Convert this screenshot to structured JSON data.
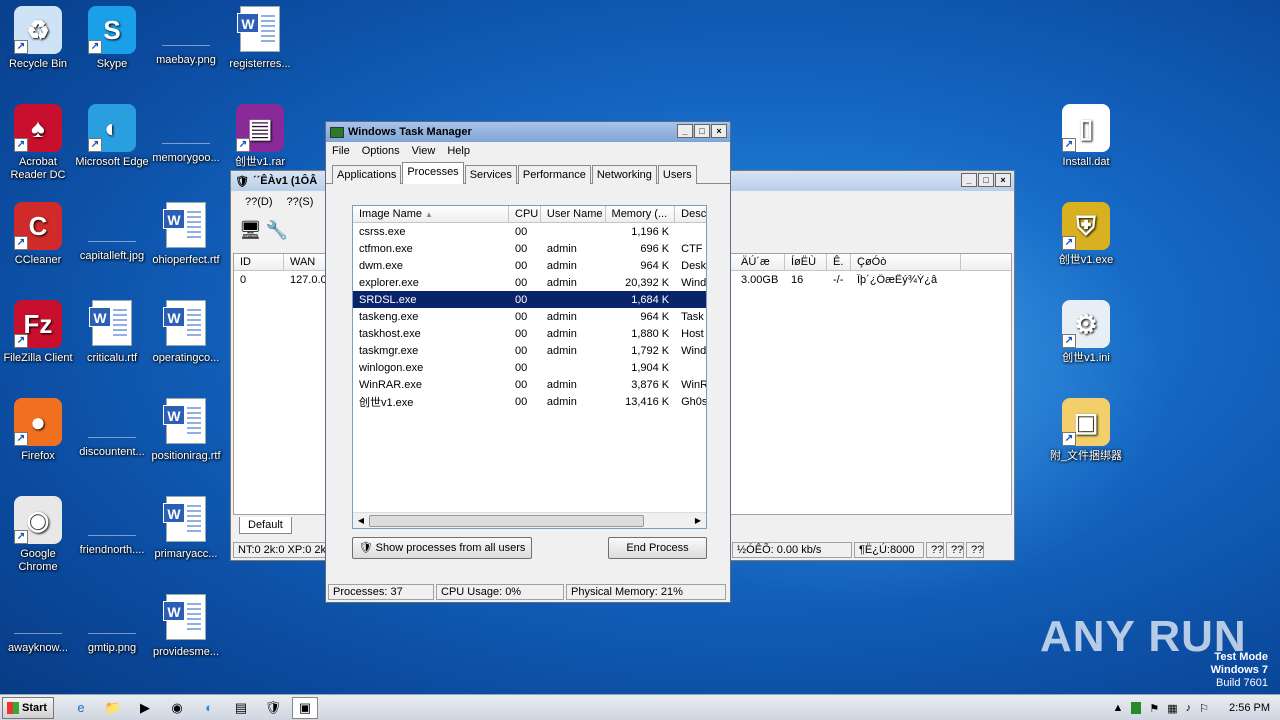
{
  "desktop": {
    "icons": [
      {
        "label": "Recycle Bin",
        "icon": "recycle-bin-icon"
      },
      {
        "label": "Skype",
        "icon": "skype-icon"
      },
      {
        "label": "maebay.png",
        "icon": "image-file-icon"
      },
      {
        "label": "registerres...",
        "icon": "word-doc-icon"
      },
      {
        "label": "Acrobat Reader DC",
        "icon": "acrobat-icon"
      },
      {
        "label": "Microsoft Edge",
        "icon": "edge-icon"
      },
      {
        "label": "memorygoo...",
        "icon": "image-file-icon"
      },
      {
        "label": "创世v1.rar",
        "icon": "winrar-icon"
      },
      {
        "label": "CCleaner",
        "icon": "ccleaner-icon"
      },
      {
        "label": "capitalleft.jpg",
        "icon": "image-file-icon"
      },
      {
        "label": "ohioperfect.rtf",
        "icon": "word-doc-icon"
      },
      {
        "label": "FileZilla Client",
        "icon": "filezilla-icon"
      },
      {
        "label": "criticalu.rtf",
        "icon": "word-doc-icon"
      },
      {
        "label": "operatingco...",
        "icon": "word-doc-icon"
      },
      {
        "label": "Firefox",
        "icon": "firefox-icon"
      },
      {
        "label": "discountent...",
        "icon": "image-file-icon"
      },
      {
        "label": "positionirag.rtf",
        "icon": "word-doc-icon"
      },
      {
        "label": "Google Chrome",
        "icon": "chrome-icon"
      },
      {
        "label": "friendnorth....",
        "icon": "image-file-icon"
      },
      {
        "label": "primaryacc...",
        "icon": "word-doc-icon"
      },
      {
        "label": "awayknow...",
        "icon": "image-file-icon"
      },
      {
        "label": "gmtip.png",
        "icon": "image-file-icon"
      },
      {
        "label": "providesme...",
        "icon": "word-doc-icon"
      },
      {
        "label": "Install.dat",
        "icon": "file-icon"
      },
      {
        "label": "创世v1.exe",
        "icon": "shield-icon"
      },
      {
        "label": "创世v1.ini",
        "icon": "settings-file-icon"
      },
      {
        "label": "附_文件捆绑器",
        "icon": "folder-icon"
      }
    ]
  },
  "backwin": {
    "title": "´´ÊÀv1 (1ÔÂ",
    "menu": [
      "??(D)",
      "??(S)"
    ],
    "cols_left": [
      "ID",
      "WAN"
    ],
    "cols_right": [
      "ÄÚ´æ",
      "ÍøËÙ",
      "Ê.",
      "ÇøÓò"
    ],
    "row_left": [
      "0",
      "127.0.0"
    ],
    "row_right": [
      "3.00GB",
      "16",
      "-/-",
      "Îþ´¿ÖæÊý¾Ý¿â"
    ],
    "tab": "Default",
    "status_left": "NT:0 2k:0 XP:0 2k3",
    "status_right": [
      "½ÓÊÕ: 0.00 kb/s",
      "¶Ë¿Ú:8000",
      "??",
      "??",
      "??"
    ]
  },
  "taskmgr": {
    "title": "Windows Task Manager",
    "menu": [
      "File",
      "Options",
      "View",
      "Help"
    ],
    "tabs": [
      "Applications",
      "Processes",
      "Services",
      "Performance",
      "Networking",
      "Users"
    ],
    "columns": [
      "Image Name",
      "CPU",
      "User Name",
      "Memory (...",
      "Desc"
    ],
    "rows": [
      {
        "name": "csrss.exe",
        "cpu": "00",
        "user": "",
        "mem": "1,196 K",
        "desc": ""
      },
      {
        "name": "ctfmon.exe",
        "cpu": "00",
        "user": "admin",
        "mem": "696 K",
        "desc": "CTF I"
      },
      {
        "name": "dwm.exe",
        "cpu": "00",
        "user": "admin",
        "mem": "964 K",
        "desc": "Desk"
      },
      {
        "name": "explorer.exe",
        "cpu": "00",
        "user": "admin",
        "mem": "20,392 K",
        "desc": "Wind"
      },
      {
        "name": "SRDSL.exe",
        "cpu": "00",
        "user": "",
        "mem": "1,684 K",
        "desc": ""
      },
      {
        "name": "taskeng.exe",
        "cpu": "00",
        "user": "admin",
        "mem": "964 K",
        "desc": "Task"
      },
      {
        "name": "taskhost.exe",
        "cpu": "00",
        "user": "admin",
        "mem": "1,880 K",
        "desc": "Host"
      },
      {
        "name": "taskmgr.exe",
        "cpu": "00",
        "user": "admin",
        "mem": "1,792 K",
        "desc": "Wind"
      },
      {
        "name": "winlogon.exe",
        "cpu": "00",
        "user": "",
        "mem": "1,904 K",
        "desc": ""
      },
      {
        "name": "WinRAR.exe",
        "cpu": "00",
        "user": "admin",
        "mem": "3,876 K",
        "desc": "WinR"
      },
      {
        "name": "创世v1.exe",
        "cpu": "00",
        "user": "admin",
        "mem": "13,416 K",
        "desc": "Gh0s"
      }
    ],
    "show_all_label": "Show processes from all users",
    "end_process_label": "End Process",
    "status": [
      "Processes: 37",
      "CPU Usage: 0%",
      "Physical Memory: 21%"
    ]
  },
  "taskbar": {
    "start_label": "Start",
    "clock": "2:56 PM"
  },
  "watermark": {
    "line1": "Test Mode",
    "line2": "Windows 7",
    "line3": "Build 7601",
    "brand": "ANY RUN"
  }
}
